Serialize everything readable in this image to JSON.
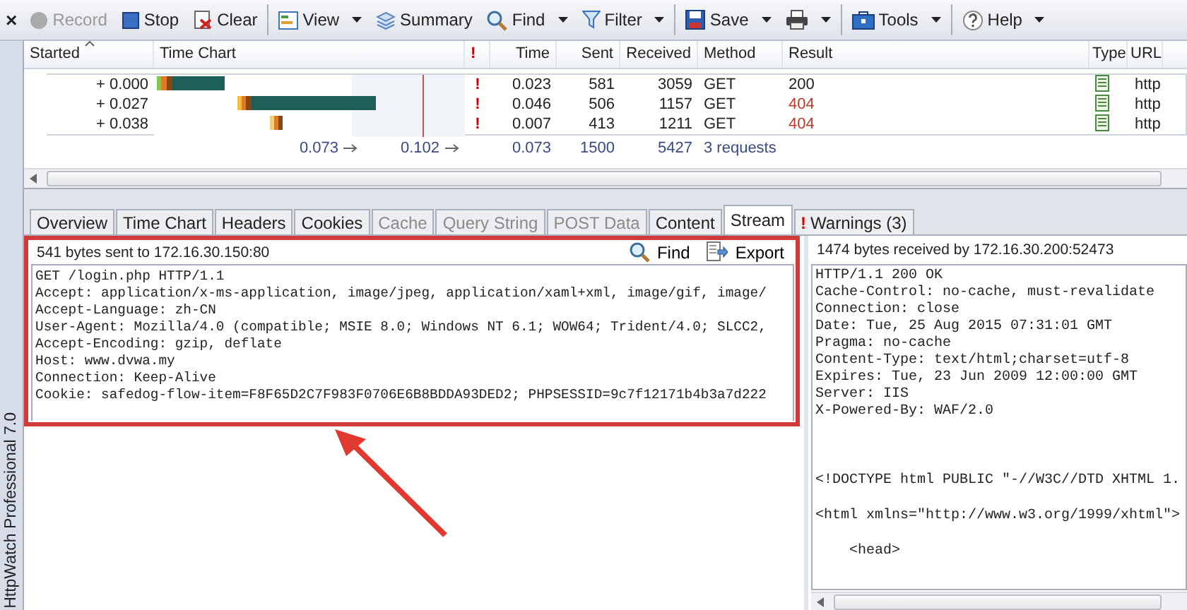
{
  "app_name": "HttpWatch Professional 7.0",
  "toolbar": [
    {
      "label": "×",
      "kind": "close",
      "disabled": false,
      "dropdown": false
    },
    {
      "label": "Record",
      "kind": "record",
      "disabled": true,
      "dropdown": false
    },
    {
      "label": "Stop",
      "kind": "stop",
      "disabled": false,
      "dropdown": false
    },
    {
      "label": "Clear",
      "kind": "clear",
      "disabled": false,
      "dropdown": false
    },
    {
      "kind": "separator"
    },
    {
      "label": "View",
      "kind": "view",
      "disabled": false,
      "dropdown": true
    },
    {
      "label": "Summary",
      "kind": "summary",
      "disabled": false,
      "dropdown": false
    },
    {
      "label": "Find",
      "kind": "find",
      "disabled": false,
      "dropdown": true
    },
    {
      "label": "Filter",
      "kind": "filter",
      "disabled": false,
      "dropdown": true
    },
    {
      "kind": "separator"
    },
    {
      "label": "Save",
      "kind": "save",
      "disabled": false,
      "dropdown": true
    },
    {
      "kind": "print",
      "disabled": false,
      "dropdown": true
    },
    {
      "kind": "separator"
    },
    {
      "label": "Tools",
      "kind": "tools",
      "disabled": false,
      "dropdown": true
    },
    {
      "kind": "separator"
    },
    {
      "label": "Help",
      "kind": "help",
      "disabled": false,
      "dropdown": true
    }
  ],
  "table": {
    "columns": [
      {
        "label": "Started",
        "sorted": true
      },
      {
        "label": "Time Chart",
        "sorted": false
      },
      {
        "label": "!",
        "sorted": false
      },
      {
        "label": "Time",
        "sorted": false
      },
      {
        "label": "Sent",
        "sorted": false
      },
      {
        "label": "Received",
        "sorted": false
      },
      {
        "label": "Method",
        "sorted": false
      },
      {
        "label": "Result",
        "sorted": false
      },
      {
        "label": "Type",
        "sorted": false
      },
      {
        "label": "URL",
        "sorted": false
      }
    ],
    "rows": [
      {
        "started": "+ 0.000",
        "warning": "!",
        "time": "0.023",
        "sent": "581",
        "received": "3059",
        "method": "GET",
        "result": "200",
        "error": false,
        "url": "http"
      },
      {
        "started": "+ 0.027",
        "warning": "!",
        "time": "0.046",
        "sent": "506",
        "received": "1157",
        "method": "GET",
        "result": "404",
        "error": true,
        "url": "http"
      },
      {
        "started": "+ 0.038",
        "warning": "!",
        "time": "0.007",
        "sent": "413",
        "received": "1211",
        "method": "GET",
        "result": "404",
        "error": true,
        "url": "http"
      }
    ],
    "totals": {
      "chart_start": "0.073",
      "chart_end": "0.102",
      "time": "0.073",
      "sent": "1500",
      "received": "5427",
      "requests": "3 requests"
    }
  },
  "tabs": [
    {
      "label": "Overview",
      "selected": false,
      "disabled": false
    },
    {
      "label": "Time Chart",
      "selected": false,
      "disabled": false
    },
    {
      "label": "Headers",
      "selected": false,
      "disabled": false
    },
    {
      "label": "Cookies",
      "selected": false,
      "disabled": false
    },
    {
      "label": "Cache",
      "selected": false,
      "disabled": true
    },
    {
      "label": "Query String",
      "selected": false,
      "disabled": true
    },
    {
      "label": "POST Data",
      "selected": false,
      "disabled": true
    },
    {
      "label": "Content",
      "selected": false,
      "disabled": false
    },
    {
      "label": "Stream",
      "selected": true,
      "disabled": false
    },
    {
      "label": "Warnings (3)",
      "selected": false,
      "disabled": false,
      "mark": "!"
    }
  ],
  "sent_panel": {
    "header": "541 bytes sent to 172.16.30.150:80",
    "buttons": [
      {
        "label": "Find",
        "kind": "find"
      },
      {
        "label": "Export",
        "kind": "export"
      }
    ],
    "lines": [
      "GET /login.php HTTP/1.1",
      "Accept: application/x-ms-application, image/jpeg, application/xaml+xml, image/gif, image/",
      "Accept-Language: zh-CN",
      "User-Agent: Mozilla/4.0 (compatible; MSIE 8.0; Windows NT 6.1; WOW64; Trident/4.0; SLCC2,",
      "Accept-Encoding: gzip, deflate",
      "Host: www.dvwa.my",
      "Connection: Keep-Alive",
      "Cookie: safedog-flow-item=F8F65D2C7F983F0706E6B8BDDA93DED2; PHPSESSID=9c7f12171b4b3a7d222"
    ]
  },
  "received_panel": {
    "header": "1474 bytes received by 172.16.30.200:52473",
    "headers": [
      "HTTP/1.1 200 OK",
      "Cache-Control: no-cache, must-revalidate",
      "Connection: close",
      "Date: Tue, 25 Aug 2015 07:31:01 GMT",
      "Pragma: no-cache",
      "Content-Type: text/html;charset=utf-8",
      "Expires: Tue, 23 Jun 2009 12:00:00 GMT",
      "Server: IIS",
      "X-Powered-By: WAF/2.0"
    ],
    "body": [
      "<!DOCTYPE html PUBLIC \"-//W3C//DTD XHTML 1.",
      "<html xmlns=\"http://www.w3.org/1999/xhtml\">",
      "    <head>"
    ]
  }
}
